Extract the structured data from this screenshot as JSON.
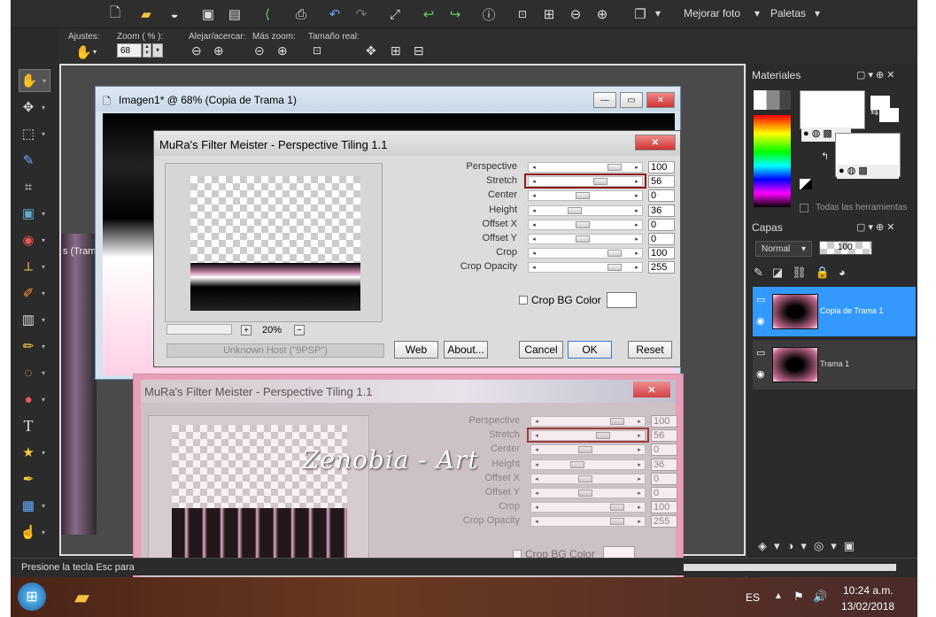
{
  "toolbar": {
    "icons": [
      "new-icon",
      "open-icon",
      "scan-icon",
      "save-icon",
      "save-as-icon",
      "share-icon",
      "print-icon",
      "undo-icon",
      "redo-icon",
      "resize-icon",
      "back-icon",
      "forward-icon",
      "info-icon",
      "actual-size-icon",
      "fit-icon",
      "zoom-out-icon",
      "zoom-in-icon",
      "copy-icon"
    ],
    "menu_enhance": "Mejorar foto",
    "menu_palettes": "Paletas",
    "dropdown_arrow": "▾"
  },
  "options_bar": {
    "ajustes": "Ajustes:",
    "zoom_label": "Zoom ( % ):",
    "zoom_value": "68",
    "alejar": "Alejar/acercar:",
    "mas_zoom": "Más zoom:",
    "tamano": "Tamaño real:"
  },
  "tools": [
    "hand",
    "move",
    "selection",
    "dropper",
    "crop",
    "image",
    "eye",
    "straighten",
    "paint",
    "gradient",
    "highlighter",
    "lasso",
    "blur",
    "text",
    "star",
    "brush",
    "grid",
    "finger"
  ],
  "image_window": {
    "title": "Imagen1* @  68% (Copia de Trama 1)",
    "behind_label": "s (Tram"
  },
  "filter_dialog": {
    "title": "MuRa's Filter Meister - Perspective Tiling 1.1",
    "params": [
      {
        "label": "Perspective",
        "value": "100"
      },
      {
        "label": "Stretch",
        "value": "56"
      },
      {
        "label": "Center",
        "value": "0"
      },
      {
        "label": "Height",
        "value": "36"
      },
      {
        "label": "Offset X",
        "value": "0"
      },
      {
        "label": "Offset Y",
        "value": "0"
      },
      {
        "label": "Crop",
        "value": "100"
      },
      {
        "label": "Crop Opacity",
        "value": "255"
      }
    ],
    "thumb_positions": [
      0.85,
      0.68,
      0.45,
      0.35,
      0.45,
      0.45,
      0.85,
      0.85
    ],
    "crop_bg_label": "Crop BG Color",
    "zoom_value": "20%",
    "plus": "+",
    "minus": "−",
    "host": "Unknown Host (\"9PSP\")",
    "web": "Web",
    "about": "About...",
    "cancel": "Cancel",
    "ok": "OK",
    "reset": "Reset",
    "close": "✕"
  },
  "watermark": "Zenobia - Art",
  "materials": {
    "title": "Materiales",
    "all_tools": "Todas las herramientas"
  },
  "layers": {
    "title": "Capas",
    "blend": "Normal",
    "opacity": "100",
    "items": [
      {
        "name": "Copia de Trama 1",
        "selected": true
      },
      {
        "name": "Trama 1",
        "selected": false
      }
    ]
  },
  "status": "Presione la tecla Esc para",
  "taskbar": {
    "lang": "ES",
    "time": "10:24 a.m.",
    "date": "13/02/2018"
  }
}
